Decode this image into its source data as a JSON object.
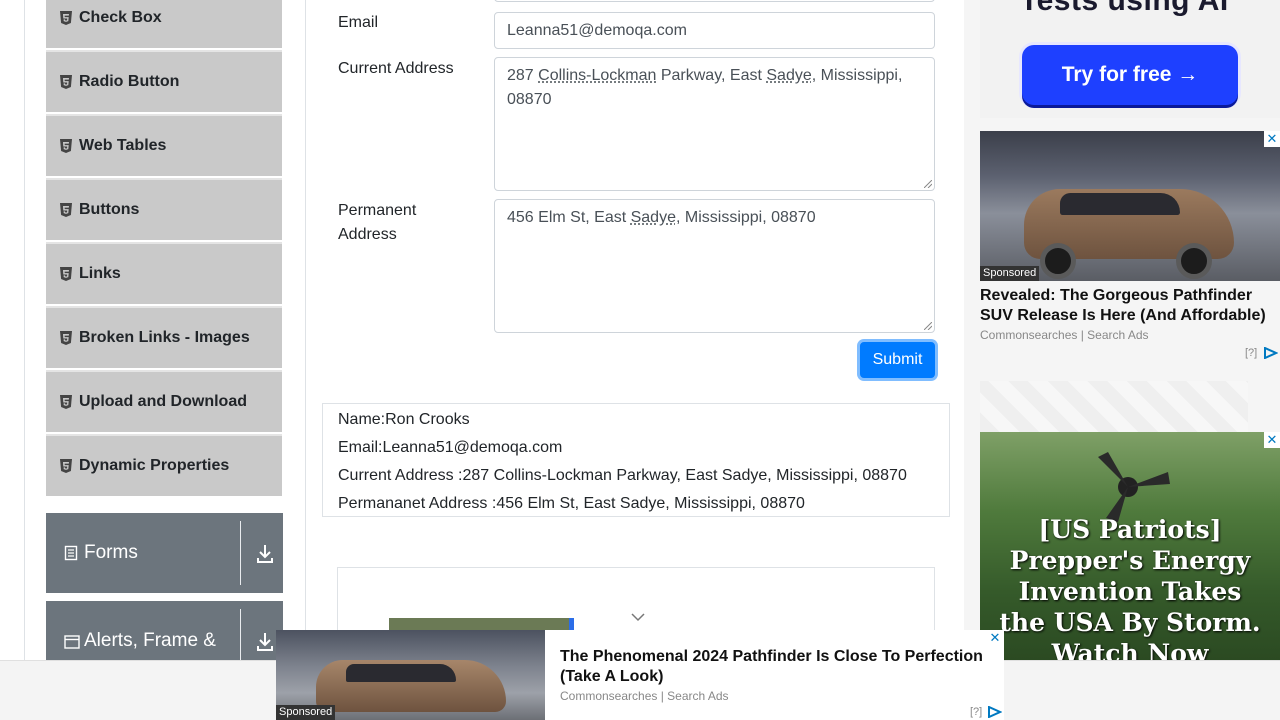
{
  "sidebar": {
    "items": [
      {
        "label": "Check Box",
        "icon": "html5-icon"
      },
      {
        "label": "Radio Button",
        "icon": "html5-icon"
      },
      {
        "label": "Web Tables",
        "icon": "html5-icon"
      },
      {
        "label": "Buttons",
        "icon": "html5-icon"
      },
      {
        "label": "Links",
        "icon": "html5-icon"
      },
      {
        "label": "Broken Links - Images",
        "icon": "html5-icon"
      },
      {
        "label": "Upload and Download",
        "icon": "html5-icon"
      },
      {
        "label": "Dynamic Properties",
        "icon": "html5-icon"
      }
    ],
    "groups": [
      {
        "label": "Forms",
        "icon": "list-icon"
      },
      {
        "label": "Alerts, Frame &",
        "icon": "window-icon"
      }
    ]
  },
  "form": {
    "email_label": "Email",
    "email_value": "Leanna51@demoqa.com",
    "current_address_label": "Current Address",
    "current_address": {
      "p1": "287 ",
      "u1": "Collins-Lockman",
      "p2": " Parkway, East ",
      "u2": "Sadye",
      "p3": ", Mississippi,",
      "p4": "08870"
    },
    "permanent_address_label_1": "Permanent",
    "permanent_address_label_2": "Address",
    "permanent_address": {
      "p1": "456 Elm St, East ",
      "u1": "Sadye",
      "p2": ", Mississippi, 08870"
    },
    "submit_label": "Submit"
  },
  "output": {
    "name": "Name:Ron Crooks",
    "email": "Email:Leanna51@demoqa.com",
    "current_address": "Current Address :287 Collins-Lockman Parkway, East Sadye, Mississippi, 08870",
    "permanent_address": "Permananet Address :456 Elm St, East Sadye, Mississippi, 08870"
  },
  "ads": {
    "top_headline": "Tests using AI",
    "top_button": "Try for free →",
    "car_ad_title": "Revealed: The Gorgeous Pathfinder SUV Release Is Here (And Affordable)",
    "car_ad_source": "Commonsearches | Search Ads",
    "sponsored": "Sponsored",
    "info": "[?]",
    "patriot_text_lines": [
      "[US Patriots]",
      "Prepper's Energy",
      "Invention Takes",
      "the USA By Storm.",
      "Watch Now"
    ],
    "bottom_title": "The Phenomenal 2024 Pathfinder Is Close To Perfection (Take A Look)",
    "bottom_source": "Commonsearches | Search Ads",
    "close": "✕"
  },
  "colors": {
    "submit_blue": "#007bff",
    "menu_gray": "#c9c9c9",
    "group_gray": "#6c757d",
    "try_button_blue": "#1e40ff"
  }
}
